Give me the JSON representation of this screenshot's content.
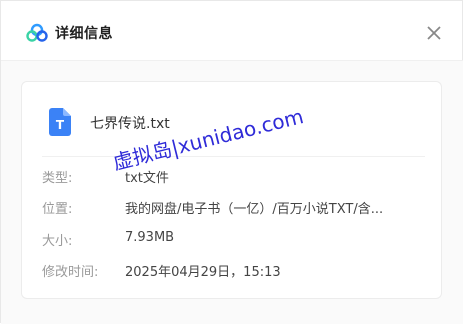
{
  "dialog": {
    "title": "详细信息"
  },
  "file": {
    "icon_letter": "T",
    "name": "七界传说.txt"
  },
  "details": {
    "type_label": "类型:",
    "type_value": "txt文件",
    "location_label": "位置:",
    "location_value": "我的网盘/电子书（一亿）/百万小说TXT/含...",
    "size_label": "大小:",
    "size_value": "7.93MB",
    "modified_label": "修改时间:",
    "modified_value": "2025年04月29日，15:13"
  },
  "watermark": "虚拟岛|xunidao.com",
  "colors": {
    "file_icon": "#3b82f6",
    "watermark": "#2f2bd8",
    "label": "#9a9a9a"
  }
}
